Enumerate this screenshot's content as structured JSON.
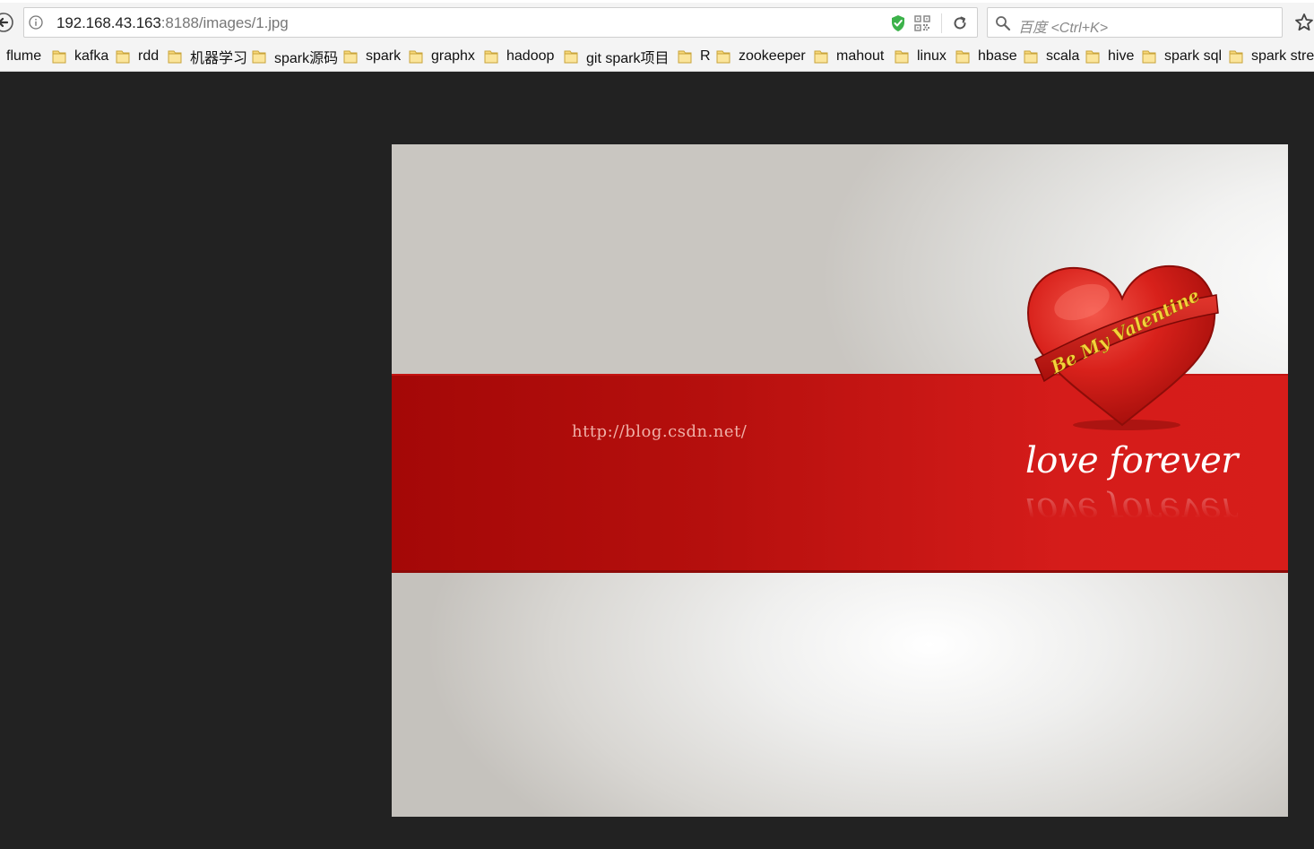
{
  "browser": {
    "url_host": "192.168.43.163",
    "url_path": ":8188/images/1.jpg",
    "search_placeholder": "百度 <Ctrl+K>"
  },
  "bookmarks": [
    {
      "label": "flume",
      "icon": "none"
    },
    {
      "label": "kafka",
      "icon": "folder-icon"
    },
    {
      "label": "rdd",
      "icon": "folder-icon"
    },
    {
      "label": "机器学习",
      "icon": "folder-icon"
    },
    {
      "label": "spark源码",
      "icon": "folder-icon"
    },
    {
      "label": "spark",
      "icon": "folder-icon"
    },
    {
      "label": "graphx",
      "icon": "folder-icon"
    },
    {
      "label": "hadoop",
      "icon": "folder-icon"
    },
    {
      "label": "git spark项目",
      "icon": "folder-icon"
    },
    {
      "label": "R",
      "icon": "folder-icon"
    },
    {
      "label": "zookeeper",
      "icon": "folder-icon"
    },
    {
      "label": "mahout",
      "icon": "folder-icon"
    },
    {
      "label": "linux",
      "icon": "folder-icon"
    },
    {
      "label": "hbase",
      "icon": "folder-icon"
    },
    {
      "label": "scala",
      "icon": "folder-icon"
    },
    {
      "label": "hive",
      "icon": "folder-icon"
    },
    {
      "label": "spark sql",
      "icon": "folder-icon"
    },
    {
      "label": "spark stre",
      "icon": "folder-icon"
    }
  ],
  "image": {
    "watermark": "http://blog.csdn.net/",
    "ribbon_text": "Be My Valentine",
    "tagline": "love forever",
    "colors": {
      "band": "#d51c1a",
      "heart": "#d8211b",
      "ribbon_text": "#f5d23a",
      "page_bg": "#222222"
    }
  }
}
